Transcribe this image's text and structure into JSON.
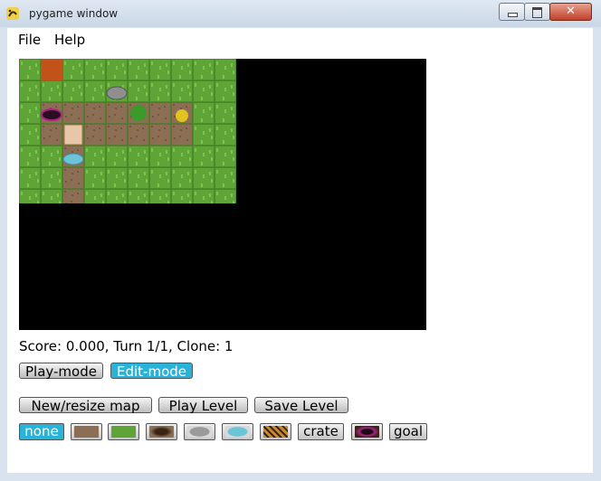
{
  "window": {
    "title": "pygame window",
    "icon": "pygame-snake-icon",
    "controls": [
      "minimize-icon",
      "maximize-icon",
      "close-icon"
    ]
  },
  "menu": {
    "items": [
      "File",
      "Help"
    ]
  },
  "map": {
    "cols": 10,
    "rows": 7,
    "legend": {
      "G": "grass",
      "D": "dirt",
      "S": "stone",
      "B": "bush",
      "Y": "yellow-flower",
      "P": "pit",
      "W": "water",
      "C": "crate",
      "R": "red-tile"
    },
    "tiles": [
      "GGGGGGGGGG",
      "GRGGGGGGGG",
      "GDDDDDDDGG",
      "GDDDDDDDGG",
      "GGDGGGGGGG",
      "GGDGGGGGGG",
      "GGDGGGGGGG"
    ],
    "objects": [
      {
        "type": "red-tile",
        "col": 1,
        "row": 0
      },
      {
        "type": "stone",
        "col": 4,
        "row": 1
      },
      {
        "type": "pit",
        "col": 1,
        "row": 2
      },
      {
        "type": "bush",
        "col": 5,
        "row": 2
      },
      {
        "type": "yellow-flower",
        "col": 7,
        "row": 2
      },
      {
        "type": "crate",
        "col": 2,
        "row": 3
      },
      {
        "type": "water",
        "col": 2,
        "row": 4
      }
    ]
  },
  "status": {
    "score_text": "Score: 0.000, Turn 1/1, Clone: 1"
  },
  "modes": {
    "play": "Play-mode",
    "edit": "Edit-mode",
    "active": "edit"
  },
  "actions": {
    "new_map": "New/resize map",
    "play_level": "Play Level",
    "save_level": "Save Level"
  },
  "tools": {
    "none": "none",
    "crate": "crate",
    "goal": "goal",
    "active": "none",
    "swatches": [
      "dirt",
      "grass",
      "pit-dark",
      "stone",
      "water",
      "crate-hatch",
      "pit-goal"
    ]
  },
  "colors": {
    "active_button": "#2ab3d8",
    "grass": "#5fa437",
    "dirt": "#8c6e55",
    "game_bg": "#000000"
  }
}
